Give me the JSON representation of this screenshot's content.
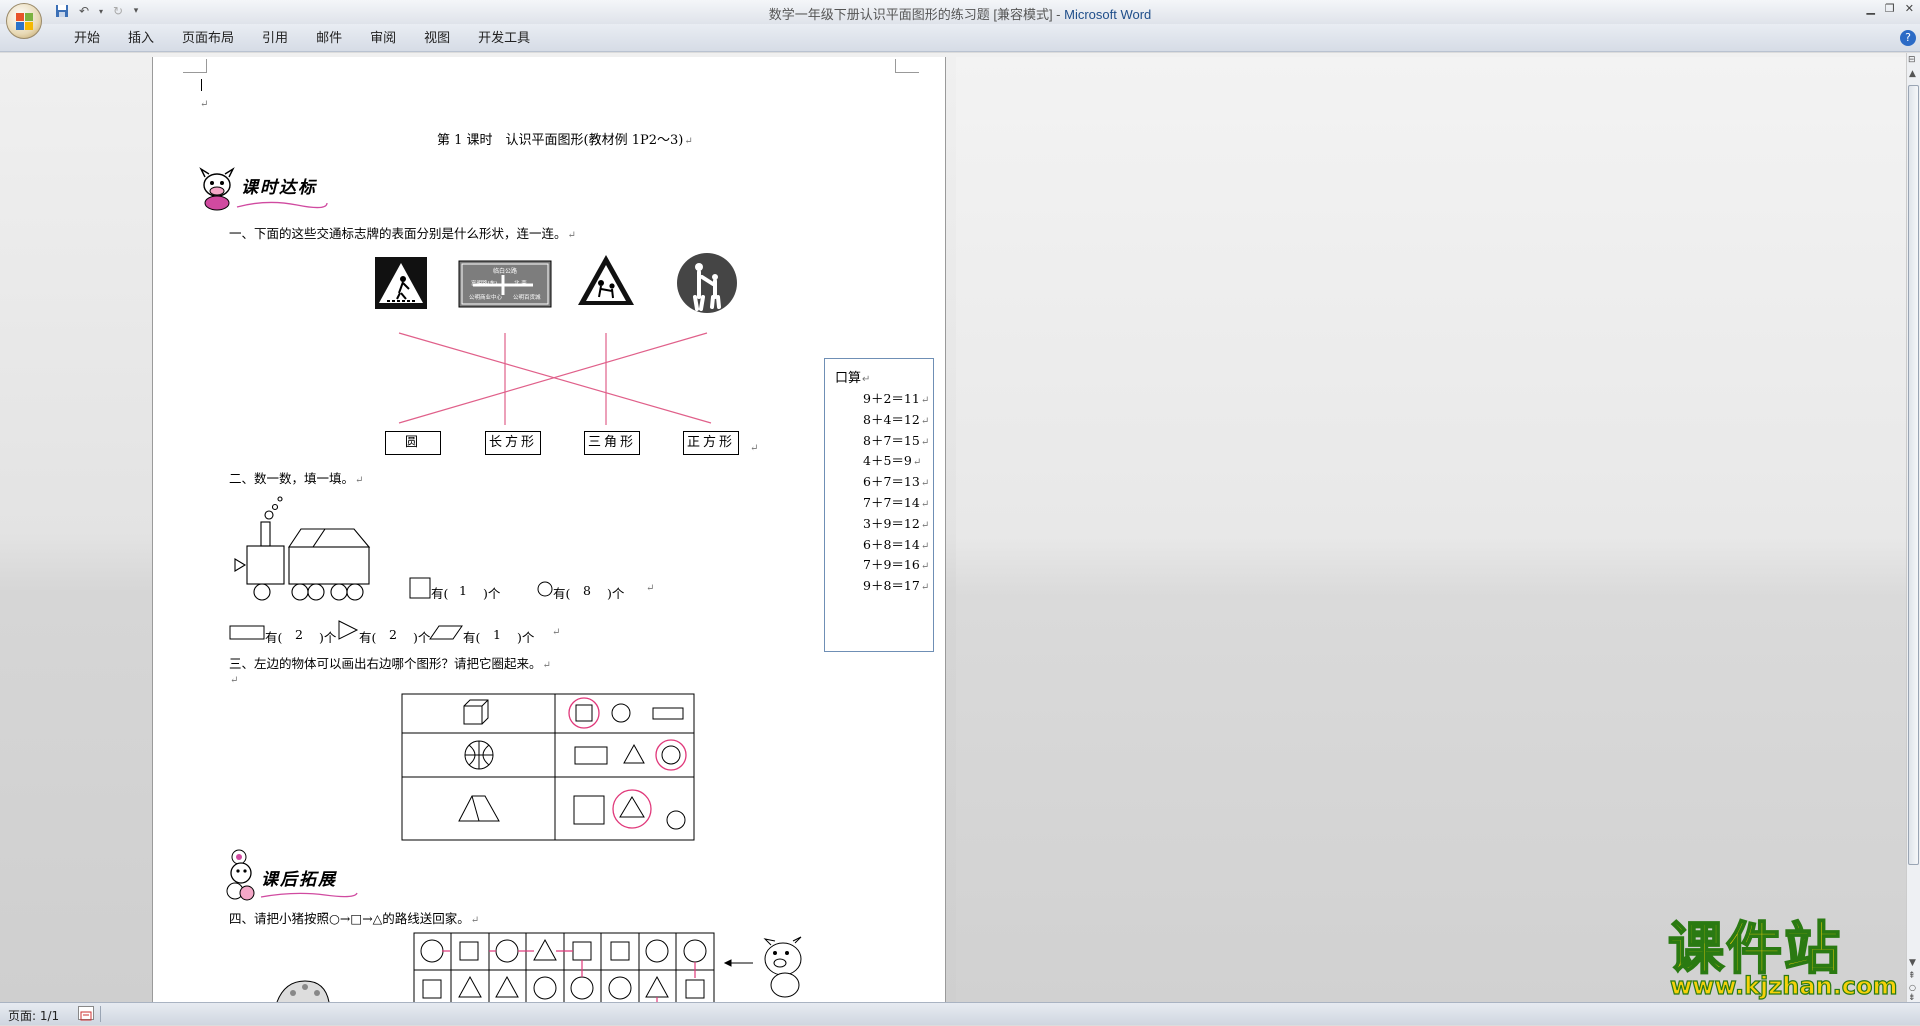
{
  "window": {
    "title_doc": "数学一年级下册认识平面图形的练习题 [兼容模式] - ",
    "title_app": "Microsoft Word"
  },
  "ribbon": {
    "tabs": [
      "开始",
      "插入",
      "页面布局",
      "引用",
      "邮件",
      "审阅",
      "视图",
      "开发工具"
    ]
  },
  "doc": {
    "heading": "第 1 课时　认识平面图形(教材例 1P2～3)",
    "section_badge_1": "课时达标",
    "section_badge_2": "课后拓展",
    "q1": "一、下面的这些交通标志牌的表面分别是什么形状，连一连。",
    "q1_sign2_lines": [
      "临白公路",
      "Linbai Rd",
      "富明路(东)",
      "Fuming Rd(E)",
      "北 南",
      "公明商业中心",
      "公明百货城"
    ],
    "q1_boxes": [
      "圆",
      "长方形",
      "三角形",
      "正方形"
    ],
    "q2": "二、数一数，填一填。",
    "q2_row1": {
      "square_label": "有(",
      "square_val": "1",
      "circle_label": "有(",
      "circle_val": "8",
      "unit": ")个"
    },
    "q2_row2": {
      "rect_val": "2",
      "tri_val": "2",
      "para_val": "1",
      "label": "有(",
      "unit": ")个"
    },
    "q3": "三、左边的物体可以画出右边哪个图形？请把它圈起来。",
    "q4": "四、请把小猪按照○→□→△的路线送回家。"
  },
  "calc_box": {
    "title": "口算",
    "lines": [
      "9＋2＝11",
      "8＋4＝12",
      "8＋7＝15",
      "4＋5＝9",
      "6＋7＝13",
      "7＋7＝14",
      "3＋9＝12",
      "6＋8＝14",
      "7＋9＝16",
      "9＋8＝17"
    ]
  },
  "status": {
    "page": "页面: 1/1"
  },
  "watermark": {
    "cn": "课件站",
    "url": "www.kjzhan.com"
  },
  "colors": {
    "accent_pink": "#e0387a",
    "link_lines": "#e0608a",
    "watermark_yellow": "#f6d10a",
    "watermark_green": "#2a7a12"
  }
}
